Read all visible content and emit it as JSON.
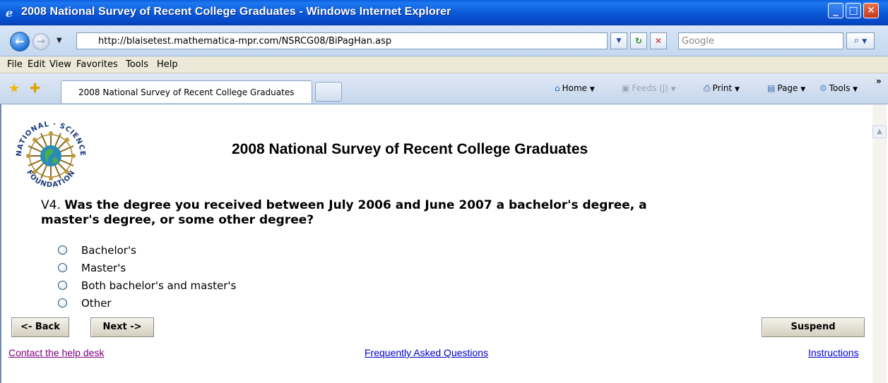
{
  "window": {
    "title": "2008 National Survey of Recent College Graduates - Windows Internet Explorer",
    "minimize": "_",
    "maximize": "□",
    "close": "✕"
  },
  "address_bar": {
    "url": "http://blaisetest.mathematica-mpr.com/NSRCG08/BiPagHan.asp",
    "search_placeholder": "Google"
  },
  "menu": [
    "File",
    "Edit",
    "View",
    "Favorites",
    "Tools",
    "Help"
  ],
  "tab": {
    "label": "2008 National Survey of Recent College Graduates"
  },
  "toolbar": {
    "home": "Home",
    "feeds": "Feeds (J)",
    "print": "Print",
    "page": "Page",
    "tools": "Tools",
    "overflow": "»"
  },
  "logo": {
    "text_top": "NATIONAL · SCIENCE",
    "text_bottom": "FOUNDATION"
  },
  "page": {
    "title": "2008 National Survey of Recent College Graduates",
    "question_number": "V4.",
    "question_text": "Was the degree you received between July 2006 and June 2007 a bachelor's degree, a master's degree, or some other degree?",
    "options": [
      "Bachelor's",
      "Master's",
      "Both bachelor's and master's",
      "Other"
    ],
    "back_label": "<- Back",
    "next_label": "Next ->",
    "suspend_label": "Suspend",
    "links": {
      "help_desk": "Contact the help desk",
      "faq": "Frequently Asked Questions",
      "instructions": "Instructions"
    }
  },
  "colors": {
    "titlebar": "#0b5ad9",
    "link": "#0000cc",
    "visited_link": "#800080",
    "button_face": "#d4d0c0"
  }
}
